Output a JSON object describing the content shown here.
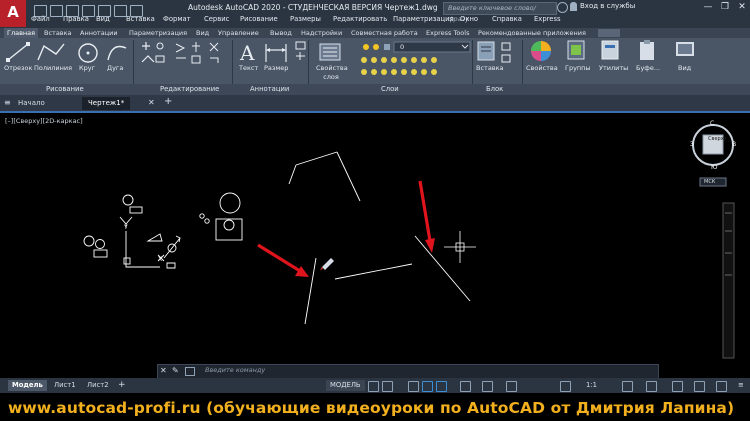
{
  "titlebar": {
    "logo": "A",
    "title": "Autodesk AutoCAD 2020 - СТУДЕНЧЕСКАЯ ВЕРСИЯ  Чертеж1.dwg",
    "search_placeholder": "Введите ключевое слово/фразу",
    "login": "Вход в службы",
    "login_icon": "user-icon"
  },
  "menubar": [
    "Файл",
    "Правка",
    "Вид",
    "Вставка",
    "Формат",
    "Сервис",
    "Рисование",
    "Размеры",
    "Редактировать",
    "Параметризация",
    "Окно",
    "Справка",
    "Express"
  ],
  "ribbon": {
    "tabs": [
      "Главная",
      "Вставка",
      "Аннотации",
      "Параметризация",
      "Вид",
      "Управление",
      "Вывод",
      "Надстройки",
      "Совместная работа",
      "Express Tools",
      "Рекомендованные приложения"
    ],
    "tools": {
      "line": "Отрезок",
      "polyline": "Полилиния",
      "circle": "Круг",
      "arc": "Дуга",
      "text": "Текст",
      "dimension": "Размер",
      "layer_properties": "Свойства слоя",
      "insert": "Вставка",
      "properties": "Свойства",
      "groups": "Группы",
      "utilities": "Утилиты",
      "clipboard": "Буфе...",
      "view": "Вид"
    },
    "layer_value": "0",
    "panels": [
      "Рисование",
      "Редактирование",
      "Аннотации",
      "Слои",
      "Блок"
    ]
  },
  "document_tabs": [
    "Начало",
    "Чертеж1*"
  ],
  "viewport": {
    "label": "[–][Сверху][2D-каркас]",
    "viewcube": {
      "top": "Сверху",
      "north": "С",
      "south": "Ю",
      "east": "В",
      "west": "З",
      "wcs": "МСК"
    }
  },
  "commandline": {
    "placeholder": "Введите команду"
  },
  "statusbar": {
    "layout_tabs": [
      "Модель",
      "Лист1",
      "Лист2"
    ],
    "mode": "МОДЕЛЬ",
    "scale": "1:1"
  },
  "banner": {
    "text": "www.autocad-profi.ru  (обучающие видеоуроки по AutoCAD от Дмитрия Лапина)"
  },
  "colors": {
    "accent": "#3a6fb1",
    "arrow": "#e0141c",
    "banner": "#f2b01e",
    "logo": "#b8202a"
  }
}
